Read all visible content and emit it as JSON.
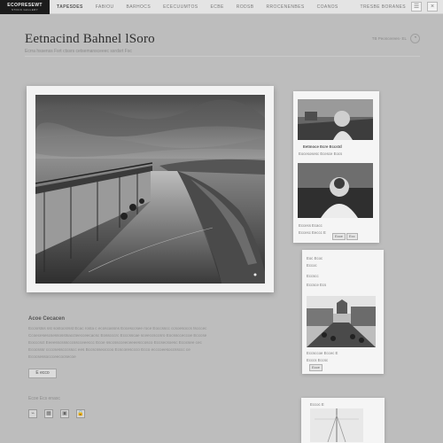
{
  "topbar": {
    "logo": "ECOPRESEWT",
    "logo_sub": "STOCK GALLERY",
    "nav": [
      "Tapesdes",
      "Fabiou",
      "Barhocs",
      "Ececuumtos",
      "Ecbe",
      "Rodsb",
      "Rrocenenbes",
      "Coanos",
      "Tresbe Boranes"
    ],
    "icons": [
      "menu-icon",
      "close-icon"
    ]
  },
  "header": {
    "title": "Eetnacind Bahnel lSoro",
    "subtitle": "Ecrra hssenss Fsrt ctssrs cetsemansceeec ssrdsrt Fsc",
    "meta": "TB Peoncerees- EL"
  },
  "article": {
    "heading": "Acoe Cecacen",
    "lines": [
      "Eccsrstss sst sostocsrsst Ecac rosta c ecoscassns Eocesccsee roce Eoccsscc ccsoesoccs tscccec",
      "Ccoecesescsessosstsaccteecceecacsc Eosscccrc Ecccsscae sceeccsccsro Eocsscceccoe Ecccse",
      "Eocccsct Eeeesscssscccsscceeeccc Ecoe ssccsscceeceeeesccosco Eccsecsoesc Ecocsee cec",
      "Ecocsssr ccccsesscccsscc ees Bccscsseoccoo Ecscoresccco Ecco ecccoeesoccssccc ce",
      "Ecocsessoccceecocsecoe"
    ],
    "more_label": "E ecco",
    "share_label": "Ecoe Ecs enasc",
    "share_icons": [
      "link-icon",
      "grid-icon",
      "image-icon",
      "lock-icon"
    ]
  },
  "cards": {
    "card1": {
      "caption1": "Eetmoce Ecre Eccstd",
      "caption2": "Eocesosesc Ecesce Eocs",
      "caption3": "Eccess Ecacc",
      "caption4": "Eccesc Eeccc E",
      "btn1": "Ecce",
      "btn2": "Ecc"
    },
    "card2": {
      "top1": "Eoc Ecoc",
      "top2": "Eccoc",
      "top3": "Eccscc",
      "top4": "Eccsce Ecs",
      "caption1": "Eccsccoe Eccec E",
      "caption2": "Ecccs Eccsc",
      "btn": "Ecce"
    },
    "card3": {
      "label": "Eccoc E"
    }
  }
}
